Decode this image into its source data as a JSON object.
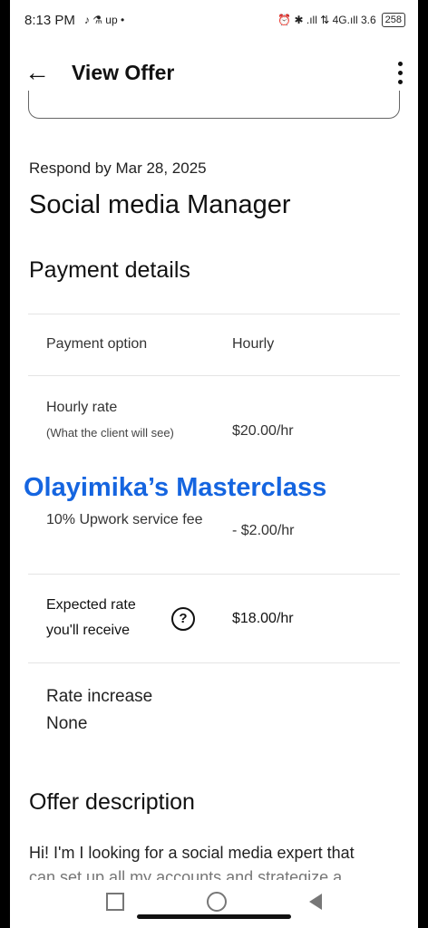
{
  "status": {
    "time": "8:13 PM",
    "apps": "♪ ⚗ up •",
    "icons": "⏰ ✱ .ıll ⇅ 4G.ıll 3.6",
    "battery": "258"
  },
  "appbar": {
    "title": "View Offer"
  },
  "offer": {
    "respond_by": "Respond by Mar 28, 2025",
    "job_title": "Social media Manager"
  },
  "payment": {
    "section_title": "Payment details",
    "rows": [
      {
        "label": "Payment option",
        "sublabel": "",
        "value": "Hourly"
      },
      {
        "label": "Hourly rate",
        "sublabel": "(What the client will see)",
        "value": "$20.00/hr"
      },
      {
        "label": "10% Upwork service fee",
        "sublabel": "",
        "value": "- $2.00/hr"
      },
      {
        "label": "Expected rate you'll receive",
        "sublabel": "",
        "value": "$18.00/hr",
        "help": "?"
      }
    ]
  },
  "rate_increase": {
    "label": "Rate increase",
    "value": "None"
  },
  "watermark": "Olayimika’s Masterclass",
  "description": {
    "section_title": "Offer description",
    "text": "Hi! I'm I looking for a social media expert that",
    "text_cut": "can set up all my accounts and strategize a"
  }
}
